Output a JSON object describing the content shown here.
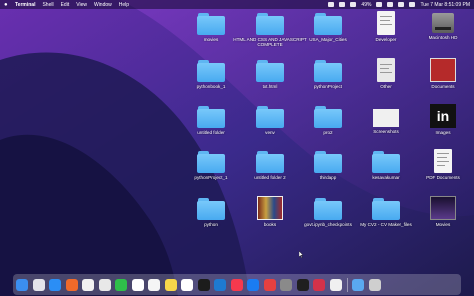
{
  "menubar": {
    "app_name": "Terminal",
    "menus": [
      "Shell",
      "Edit",
      "View",
      "Window",
      "Help"
    ],
    "battery": "49%",
    "datetime": "Tue 7 Mar 8:51:09 PM"
  },
  "desktop": {
    "items": [
      {
        "label": "movies",
        "kind": "folder"
      },
      {
        "label": "HTML AND CSS AND JAVASCRIPT COMPLETE",
        "kind": "folder"
      },
      {
        "label": "USA_Major_Cities",
        "kind": "folder"
      },
      {
        "label": "Developer",
        "kind": "file"
      },
      {
        "label": "Macintosh HD",
        "kind": "drive"
      },
      {
        "label": "pythonbook_1",
        "kind": "folder"
      },
      {
        "label": "txt.html",
        "kind": "folder"
      },
      {
        "label": "pythonProject",
        "kind": "folder"
      },
      {
        "label": "Other",
        "kind": "file"
      },
      {
        "label": "Documents",
        "kind": "image"
      },
      {
        "label": "untitled folder",
        "kind": "folder"
      },
      {
        "label": "venv",
        "kind": "folder"
      },
      {
        "label": "pro2",
        "kind": "folder"
      },
      {
        "label": "Screenshots",
        "kind": "file"
      },
      {
        "label": "Images",
        "kind": "image"
      },
      {
        "label": "pythonProject_1",
        "kind": "folder"
      },
      {
        "label": "untitled folder 2",
        "kind": "folder"
      },
      {
        "label": "thirdapp",
        "kind": "folder"
      },
      {
        "label": "kesavakumar",
        "kind": "folder"
      },
      {
        "label": "PDF Documents",
        "kind": "file"
      },
      {
        "label": "python",
        "kind": "folder"
      },
      {
        "label": "books",
        "kind": "image"
      },
      {
        "label": "govt.ipynb_checkpoints",
        "kind": "folder"
      },
      {
        "label": "My CV2 - CV Maker_files",
        "kind": "folder"
      },
      {
        "label": "Movies",
        "kind": "image"
      }
    ]
  },
  "dock": {
    "apps": [
      {
        "name": "finder-icon",
        "color": "#3b8ef0"
      },
      {
        "name": "launchpad-icon",
        "color": "#e4e4ea"
      },
      {
        "name": "safari-icon",
        "color": "#2b8ef5"
      },
      {
        "name": "firefox-icon",
        "color": "#f06a2a"
      },
      {
        "name": "photos-icon",
        "color": "#f2f2f2"
      },
      {
        "name": "chrome-icon",
        "color": "#e8e8e8"
      },
      {
        "name": "facetime-icon",
        "color": "#2fbf4a"
      },
      {
        "name": "calendar-icon",
        "color": "#ffffff"
      },
      {
        "name": "reminders-icon",
        "color": "#f5f5f5"
      },
      {
        "name": "notes-icon",
        "color": "#f7d64a"
      },
      {
        "name": "podcasts-icon",
        "color": "#ffffff"
      },
      {
        "name": "tv-icon",
        "color": "#1c1c1c"
      },
      {
        "name": "vscode-icon",
        "color": "#1e7ad1"
      },
      {
        "name": "music-icon",
        "color": "#f6394e"
      },
      {
        "name": "app-store-icon",
        "color": "#1a7cf2"
      },
      {
        "name": "mail-icon",
        "color": "#e64040"
      },
      {
        "name": "system-settings-icon",
        "color": "#8a8a8a"
      },
      {
        "name": "terminal-icon",
        "color": "#1f1f1f"
      },
      {
        "name": "word-icon",
        "color": "#d4324a"
      },
      {
        "name": "preview-icon",
        "color": "#f0f0f0"
      },
      {
        "name": "downloads-icon",
        "color": "#5aa9f0"
      },
      {
        "name": "trash-icon",
        "color": "#cfcfcf"
      }
    ]
  }
}
